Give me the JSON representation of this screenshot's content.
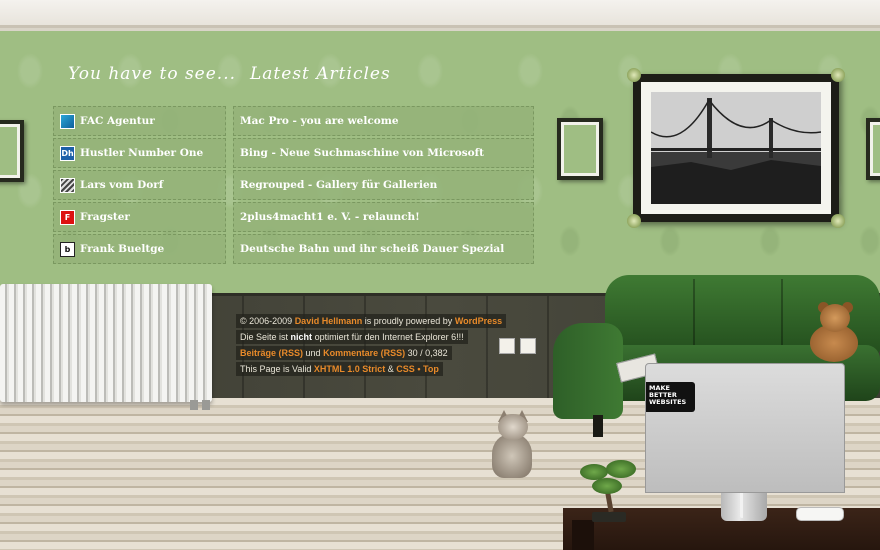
{
  "headings": {
    "visit": "You have to see...",
    "articles": "Latest Articles"
  },
  "visit_links": [
    {
      "label": "FAC Agentur",
      "icon": "fac-agentur-favicon",
      "glyph": ""
    },
    {
      "label": "Hustler Number One",
      "icon": "hustler-number-one-favicon",
      "glyph": "Dh"
    },
    {
      "label": "Lars vom Dorf",
      "icon": "lars-vom-dorf-favicon",
      "glyph": ""
    },
    {
      "label": "Fragster",
      "icon": "fragster-favicon",
      "glyph": "F"
    },
    {
      "label": "Frank Bueltge",
      "icon": "frank-bueltge-favicon",
      "glyph": "b"
    }
  ],
  "articles": [
    {
      "label": "Mac Pro - you are welcome"
    },
    {
      "label": "Bing - Neue Suchmaschine von Microsoft"
    },
    {
      "label": "Regrouped - Gallery für Gallerien"
    },
    {
      "label": "2plus4macht1 e. V. - relaunch!"
    },
    {
      "label": "Deutsche Bahn und ihr scheiß Dauer Spezial"
    }
  ],
  "footer": {
    "line1_prefix": "© 2006-2009",
    "author": "David Hellmann",
    "line1_mid": "is proudly powered by",
    "wordpress": "WordPress",
    "line2_prefix": "Die Seite ist",
    "line2_bold": "nicht",
    "line2_suffix": "optimiert für den Internet Explorer 6!!!",
    "rss_posts": "Beiträge (RSS)",
    "rss_and": "und",
    "rss_comments": "Kommentare (RSS)",
    "stats": "30 / 0,382",
    "valid_prefix": "This Page is Valid",
    "xhtml": "XHTML 1.0 Strict",
    "amp": "&",
    "css": "CSS",
    "dot": "•",
    "top": "Top"
  },
  "sticker": {
    "line1": "MAKE",
    "line2": "BETTER",
    "line3": "WEBSITES"
  },
  "apple_glyph": "",
  "colors": {
    "wall": "#9fbe83",
    "link_accent": "#e88a2a",
    "panel_row": "#94b379"
  }
}
